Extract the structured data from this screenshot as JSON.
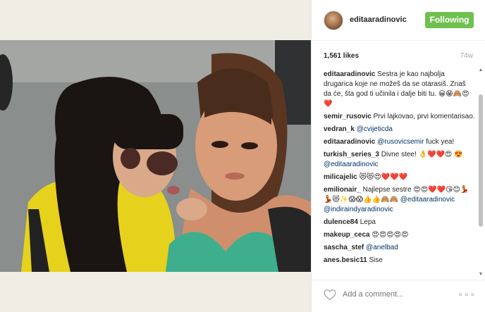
{
  "post": {
    "username": "editaaradinovic",
    "follow_label": "Following",
    "likes": "1,561 likes",
    "age": "74w",
    "add_comment_placeholder": "Add a comment...",
    "more_label": "∘∘∘"
  },
  "comments": [
    {
      "user": "editaaradinovic",
      "text": "Sestra je kao najbolja drugarica koje ne možeš da se otarasiš. Znaš da će, šta god ti učinila i dalje biti tu.",
      "emoji": "😀😁🙈😍❤️"
    },
    {
      "user": "semir_rusovic",
      "text": "Prvi lajkovao, prvi komentarisao."
    },
    {
      "user": "vedran_k",
      "mention": "@cvijeticda"
    },
    {
      "user": "editaaradinovic",
      "mention": "@rusovicsemir",
      "text": "fuck yea!"
    },
    {
      "user": "turkish_series_3",
      "text": "Divne stee!",
      "emoji": "👌❤️❤️😍",
      "mention": "😍 @editaaradinovic"
    },
    {
      "user": "milicajelic",
      "emoji": "😻😻😍❤️❤️❤️"
    },
    {
      "user": "emilionair_",
      "text": "Najlepse sestre",
      "emoji": "😍😍❤️❤️😘😊💃💃😻✨😱😱👍👍🙈🙈",
      "mention": "@editaaradinovic @indiraindyaradinovic"
    },
    {
      "user": "dulence84",
      "text": "Lepa"
    },
    {
      "user": "makeup_ceca",
      "emoji": "😍😍😍😍😍"
    },
    {
      "user": "sascha_stef",
      "mention": "@anelbad"
    },
    {
      "user": "anes.besic11",
      "text": "Sise"
    }
  ]
}
